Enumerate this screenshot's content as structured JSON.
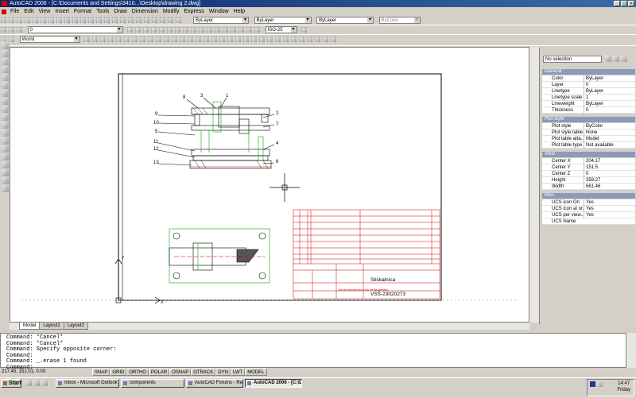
{
  "title": "AutoCAD 2006 - [C:\\Documents and Settings\\3410...\\Desktop\\drawing 2.dwg]",
  "menu": [
    "File",
    "Edit",
    "View",
    "Insert",
    "Format",
    "Tools",
    "Draw",
    "Dimension",
    "Modify",
    "Express",
    "Window",
    "Help"
  ],
  "toolbar": {
    "layer_combo": "ByLayer",
    "linetype_combo": "ByLayer",
    "lineweight_combo": "ByLayer",
    "plotstyle_combo": "ByColor",
    "layer_name": "0",
    "dimstyle": "ISO-25",
    "ucs": "World"
  },
  "props": {
    "selection": "No selection",
    "sections": {
      "general": "General",
      "plot": "Plot style",
      "view": "View",
      "misc": "Misc"
    },
    "general": [
      {
        "k": "Color",
        "v": "ByLayer"
      },
      {
        "k": "Layer",
        "v": "0"
      },
      {
        "k": "Linetype",
        "v": "ByLayer"
      },
      {
        "k": "Linetype scale",
        "v": "1"
      },
      {
        "k": "Lineweight",
        "v": "ByLayer"
      },
      {
        "k": "Thickness",
        "v": "0"
      }
    ],
    "plot": [
      {
        "k": "Plot style",
        "v": "ByColor"
      },
      {
        "k": "Plot style table",
        "v": "None"
      },
      {
        "k": "Plot table atta...",
        "v": "Model"
      },
      {
        "k": "Plot table type",
        "v": "Not available"
      }
    ],
    "view": [
      {
        "k": "Center X",
        "v": "204.17"
      },
      {
        "k": "Center Y",
        "v": "151.5"
      },
      {
        "k": "Center Z",
        "v": "0"
      },
      {
        "k": "Height",
        "v": "359.27"
      },
      {
        "k": "Width",
        "v": "661.46"
      }
    ],
    "misc": [
      {
        "k": "UCS icon On",
        "v": "Yes"
      },
      {
        "k": "UCS icon at or...",
        "v": "Yes"
      },
      {
        "k": "UCS per view...",
        "v": "Yes"
      },
      {
        "k": "UCS Name",
        "v": ""
      }
    ]
  },
  "tabs": [
    "Model",
    "Layout1",
    "Layout2"
  ],
  "drawing": {
    "labels": [
      "8",
      "3",
      "1",
      "9",
      "2",
      "10",
      "7",
      "5",
      "11",
      "4",
      "12",
      "6",
      "13"
    ],
    "title_block_name": "Stiskalnica",
    "drawing_no": "VSŠ-23020273",
    "organization": "Visoka strokovna šola za strojništvo"
  },
  "command_lines": [
    "Command: *Cancel*",
    "Command: *Cancel*",
    "Command: Specify opposite corner:",
    "Command:",
    "Command: _.erase 1 found"
  ],
  "command_prompt": "Command:",
  "status": {
    "coords": "217.45, 151.01, 0.00",
    "buttons": [
      "SNAP",
      "GRID",
      "ORTHO",
      "POLAR",
      "OSNAP",
      "OTRACK",
      "DYN",
      "LWT",
      "MODEL"
    ]
  },
  "taskbar": {
    "start": "Start",
    "tasks": [
      "Inbox - Microsoft Outlook",
      "components",
      "AutoCAD Forums - Reply...",
      "AutoCAD 2006 - [C:\\D..."
    ],
    "time": "14:47",
    "day": "Friday"
  },
  "colors": {
    "titlebar": "#0a246a",
    "drawing_red": "#cc0000",
    "drawing_green": "#00aa00",
    "drawing_magenta": "#cc00cc"
  }
}
